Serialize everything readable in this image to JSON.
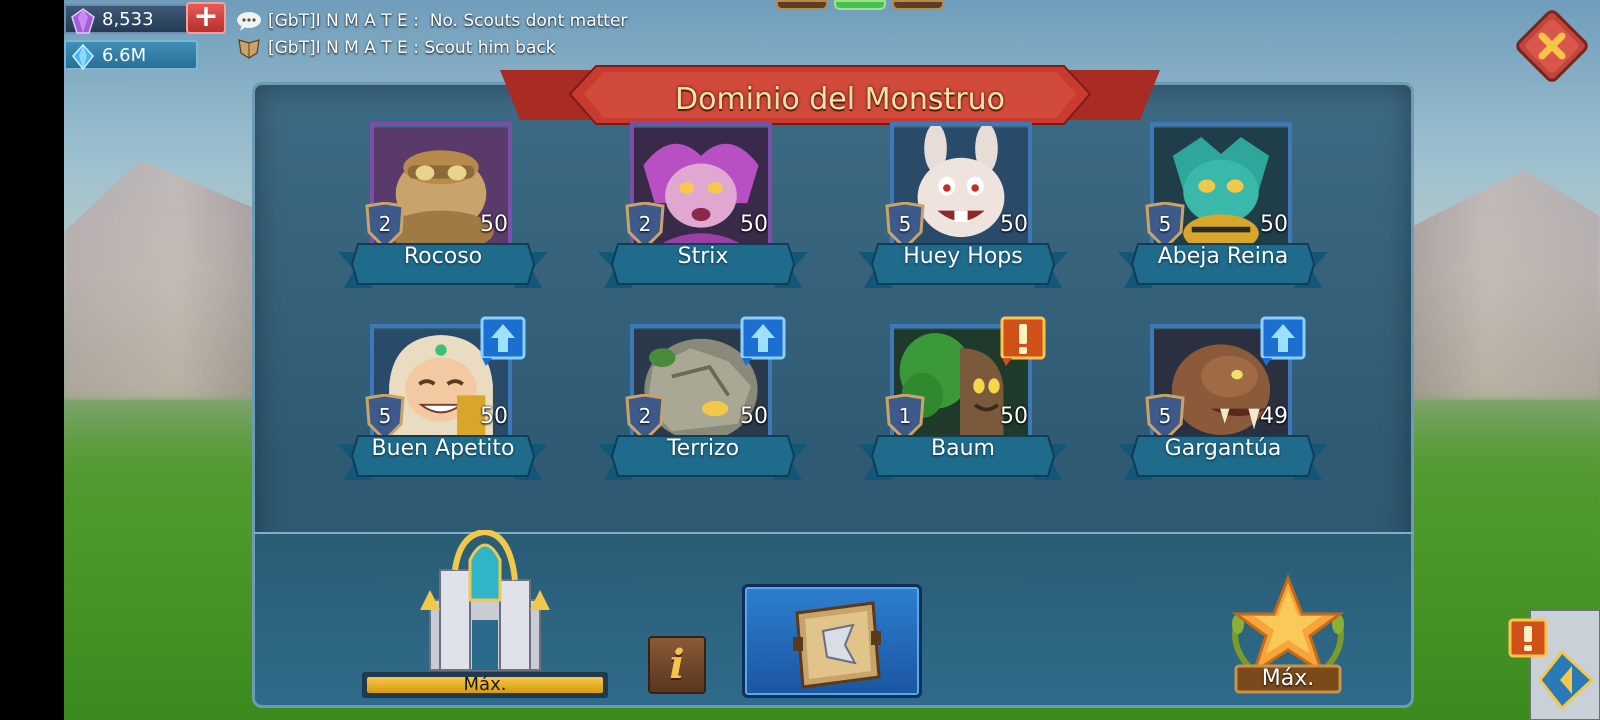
{
  "resources": {
    "gems": "8,533",
    "mana": "6.6M"
  },
  "chat": [
    {
      "sender": "[GbT]I N M A T E :",
      "message": "No. Scouts dont matter"
    },
    {
      "sender": "[GbT]I N M A T E :",
      "message": "Scout him back"
    }
  ],
  "panel": {
    "title": "Dominio del Monstruo"
  },
  "monsters": [
    {
      "name": "Rocoso",
      "level": "2",
      "power": "50"
    },
    {
      "name": "Strix",
      "level": "2",
      "power": "50"
    },
    {
      "name": "Huey Hops",
      "level": "5",
      "power": "50"
    },
    {
      "name": "Abeja Reina",
      "level": "5",
      "power": "50"
    },
    {
      "name": "Buen Apetito",
      "level": "5",
      "power": "50",
      "badge": "upgrade"
    },
    {
      "name": "Terrizo",
      "level": "2",
      "power": "50",
      "badge": "upgrade"
    },
    {
      "name": "Baum",
      "level": "1",
      "power": "50",
      "badge": "alert"
    },
    {
      "name": "Gargantúa",
      "level": "5",
      "power": "49",
      "badge": "upgrade"
    }
  ],
  "footer": {
    "building_label": "Máx.",
    "building_progress": 1.0,
    "info_label": "i",
    "rank_label": "Máx."
  },
  "icons": {
    "gems": "purple-gem-icon",
    "mana": "blue-crystal-icon",
    "add": "plus-icon",
    "close": "close-icon",
    "upgrade": "upgrade-arrow-icon",
    "alert": "alert-icon",
    "book": "book-icon",
    "star": "star-medal-icon"
  },
  "colors": {
    "accent_red": "#c93a30",
    "panel": "#2f5a73",
    "ribbon": "#1e6b8c",
    "gold": "#f4c44a"
  }
}
